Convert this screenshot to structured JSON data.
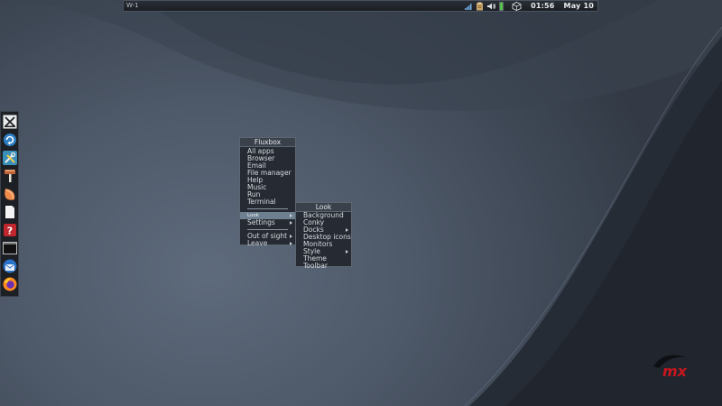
{
  "toolbar": {
    "workspace": "W-1",
    "clock_time": "01:56",
    "clock_date": "May 10",
    "tray_icons": [
      "network-signal-icon",
      "clipboard-icon",
      "volume-icon",
      "battery-icon",
      "package-updater-icon"
    ]
  },
  "dock": {
    "items": [
      {
        "icon": "mx-logo-icon"
      },
      {
        "icon": "refresh-icon"
      },
      {
        "icon": "tools-icon"
      },
      {
        "icon": "paint-brush-icon"
      },
      {
        "icon": "file-manager-icon"
      },
      {
        "icon": "document-icon"
      },
      {
        "icon": "help-icon"
      },
      {
        "icon": "terminal-icon"
      },
      {
        "icon": "thunderbird-icon"
      },
      {
        "icon": "firefox-icon"
      }
    ]
  },
  "root_menu": {
    "title": "Fluxbox",
    "items": [
      "All apps",
      "Browser",
      "Email",
      "File manager",
      "Help",
      "Music",
      "Run",
      "Terminal"
    ],
    "look": "Look",
    "settings": "Settings",
    "out_of_sight": "Out of sight",
    "leave": "Leave"
  },
  "look_menu": {
    "title": "Look",
    "items": [
      "Background",
      "Conky",
      "Docks",
      "Desktop icons",
      "Monitors",
      "Style",
      "Theme",
      "Toolbar"
    ]
  },
  "colors": {
    "desktop": "#4d5868",
    "menu_bg": "#262b33",
    "menu_selected": "#6c8090",
    "mx_logo": "#c8161e"
  }
}
